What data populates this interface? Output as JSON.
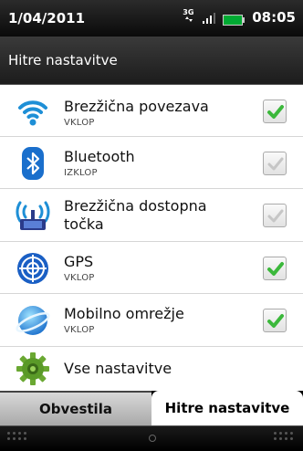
{
  "status_bar": {
    "date": "1/04/2011",
    "network": "3G",
    "time": "08:05"
  },
  "header": {
    "title": "Hitre nastavitve"
  },
  "rows": [
    {
      "title": "Brezžična povezava",
      "subtitle": "VKLOP",
      "icon": "wifi-icon",
      "checked": true
    },
    {
      "title": "Bluetooth",
      "subtitle": "IZKLOP",
      "icon": "bluetooth-icon",
      "checked": false
    },
    {
      "title": "Brezžična dostopna točka",
      "subtitle": "",
      "icon": "hotspot-icon",
      "checked": false
    },
    {
      "title": "GPS",
      "subtitle": "VKLOP",
      "icon": "gps-icon",
      "checked": true
    },
    {
      "title": "Mobilno omrežje",
      "subtitle": "VKLOP",
      "icon": "mobile-network-icon",
      "checked": true
    },
    {
      "title": "Vse nastavitve",
      "subtitle": "",
      "icon": "gear-icon",
      "checked": null
    }
  ],
  "tabs": [
    {
      "label": "Obvestila",
      "active": false
    },
    {
      "label": "Hitre nastavitve",
      "active": true
    }
  ],
  "colors": {
    "check_green": "#3bb83b",
    "check_disabled": "#b8b8b8"
  }
}
